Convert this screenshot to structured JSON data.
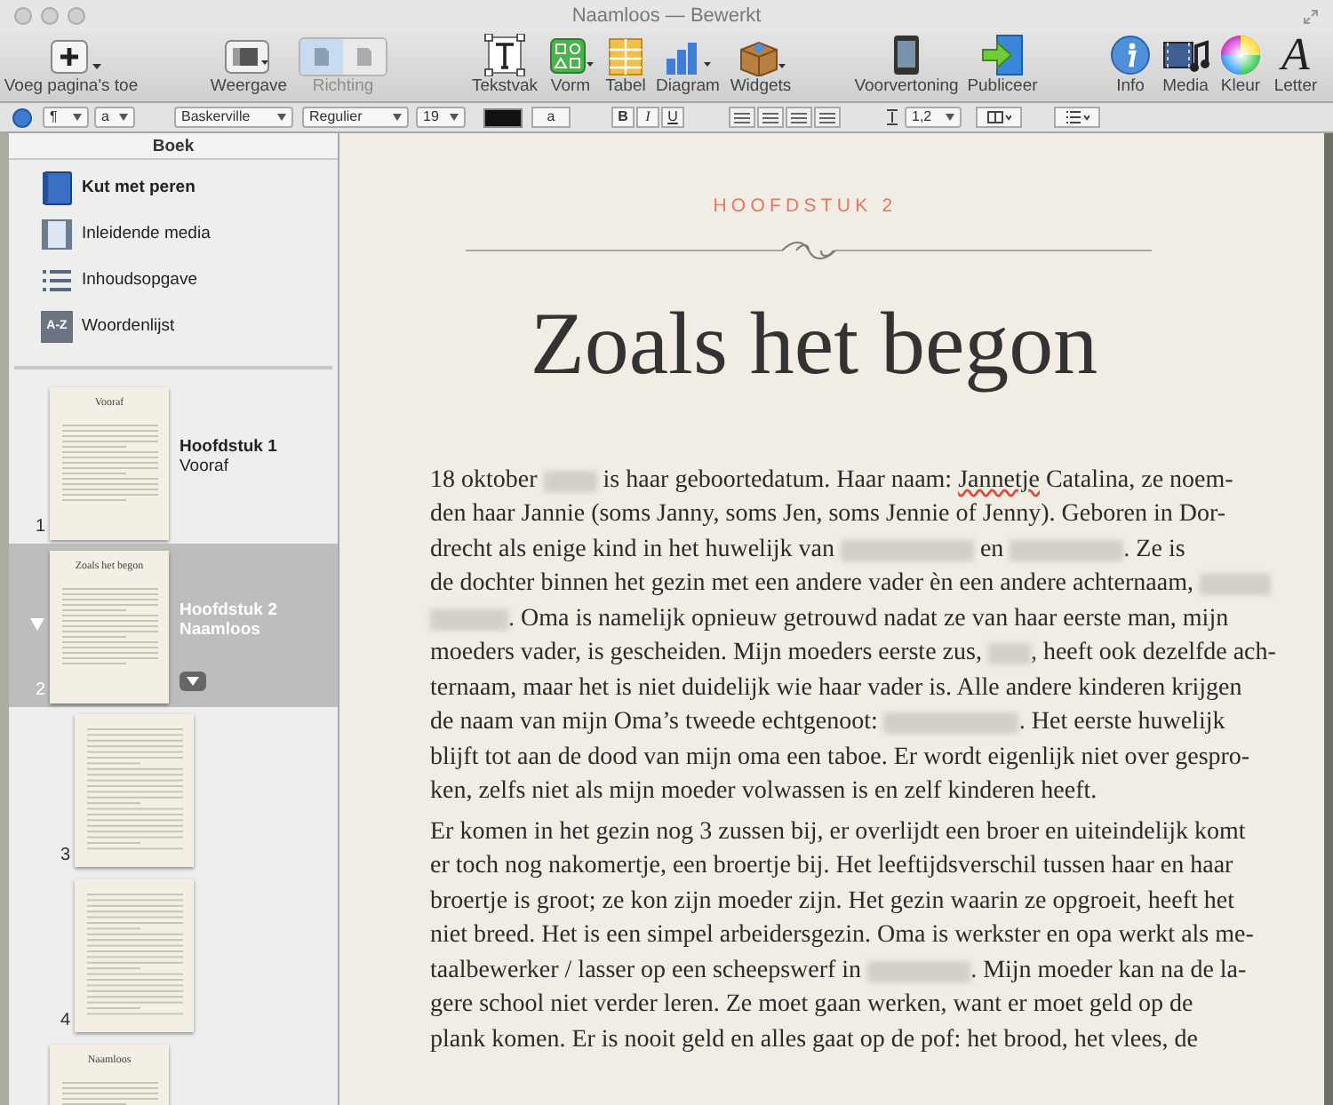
{
  "window": {
    "title": "Naamloos — Bewerkt"
  },
  "toolbar": [
    {
      "kind": "add_pages",
      "label": "Voeg pagina's toe",
      "disabled": false
    },
    {
      "kind": "view",
      "label": "Weergave",
      "disabled": false
    },
    {
      "kind": "orientation",
      "label": "Richting",
      "disabled": true,
      "segments": [
        {
          "selected": true
        },
        {
          "selected": false
        }
      ]
    },
    {
      "kind": "textbox",
      "label": "Tekstvak",
      "disabled": false
    },
    {
      "kind": "shape",
      "label": "Vorm",
      "disabled": false
    },
    {
      "kind": "table",
      "label": "Tabel",
      "disabled": false
    },
    {
      "kind": "chart",
      "label": "Diagram",
      "disabled": false
    },
    {
      "kind": "widget",
      "label": "Widgets",
      "disabled": false
    },
    {
      "kind": "preview",
      "label": "Voorvertoning",
      "disabled": false
    },
    {
      "kind": "publish",
      "label": "Publiceer",
      "disabled": false
    },
    {
      "kind": "info",
      "label": "Info",
      "disabled": false
    },
    {
      "kind": "media",
      "label": "Media",
      "disabled": false
    },
    {
      "kind": "color",
      "label": "Kleur",
      "disabled": false
    },
    {
      "kind": "font",
      "label": "Letter",
      "disabled": false,
      "glyph": "A"
    }
  ],
  "format_bar": {
    "paragraph_style": "¶",
    "character_style": "a",
    "font": "Baskerville",
    "typeface": "Regulier",
    "size": "19",
    "highlight": "a",
    "bold": "B",
    "italic": "I",
    "underline": "U",
    "line_spacing": "1,2"
  },
  "sidebar": {
    "header": "Boek",
    "items": [
      {
        "kind": "book",
        "label": "Kut met peren"
      },
      {
        "kind": "media",
        "label": "Inleidende media"
      },
      {
        "kind": "toc",
        "label": "Inhoudsopgave"
      },
      {
        "kind": "glossary",
        "label": "Woordenlijst",
        "badge": "A-Z"
      }
    ],
    "pages": [
      {
        "kind": "chapter",
        "number": "1",
        "title": "Hoofdstuk 1",
        "subtitle": "Vooraf",
        "thumb_title": "Vooraf",
        "selected": false
      },
      {
        "kind": "chapter",
        "number": "2",
        "title": "Hoofdstuk 2",
        "subtitle": "Naamloos",
        "thumb_title": "Zoals het begon",
        "selected": true
      },
      {
        "kind": "page",
        "number": "3",
        "selected": false
      },
      {
        "kind": "page",
        "number": "4",
        "selected": false
      },
      {
        "kind": "chapter",
        "thumb_title": "Naamloos",
        "selected": false
      }
    ]
  },
  "document": {
    "chapter_label": "HOOFDSTUK 2",
    "title": "Zoals het begon",
    "paragraphs": [
      [
        [
          "18 oktober ",
          {
            "kind": "redacted"
          },
          " is haar geboortedatum. Haar naam: ",
          {
            "kind": "misspelled",
            "text": "Jannetje"
          },
          " Catalina, ze noem-"
        ],
        [
          "den haar Jannie (soms Janny, soms Jen, soms Jennie of Jenny). Geboren in Dor-"
        ],
        [
          "drecht als enige kind in het huwelijk van ",
          {
            "kind": "redacted"
          },
          " en ",
          {
            "kind": "redacted"
          },
          ". Ze is"
        ],
        [
          "de dochter binnen het gezin met een andere vader èn een andere achternaam, ",
          {
            "kind": "redacted"
          }
        ],
        [
          {
            "kind": "redacted"
          },
          ". Oma is namelijk opnieuw getrouwd nadat ze van haar eerste man, mijn"
        ],
        [
          "moeders vader, is gescheiden. Mijn moeders eerste zus, ",
          {
            "kind": "redacted"
          },
          ", heeft ook dezelfde ach-"
        ],
        [
          "ternaam, maar het is niet duidelijk wie haar vader is. Alle andere kinderen krijgen"
        ],
        [
          "de naam van mijn Oma’s tweede echtgenoot: ",
          {
            "kind": "redacted"
          },
          ". Het eerste huwelijk"
        ],
        [
          "blijft tot aan de dood van mijn oma een taboe. Er wordt eigenlijk niet over gespro-"
        ],
        [
          "ken, zelfs niet als mijn moeder volwassen is en zelf kinderen heeft."
        ]
      ],
      [
        [
          "Er komen in het gezin nog 3 zussen bij, er overlijdt een broer en uiteindelijk komt"
        ],
        [
          "er toch nog nakomertje, een broertje bij. Het leeftijdsverschil tussen haar en haar"
        ],
        [
          "broertje is groot; ze kon zijn moeder zijn. Het gezin waarin ze opgroeit, heeft het"
        ],
        [
          "niet breed. Het is een simpel arbeidersgezin. Oma is werkster en opa werkt als me-"
        ],
        [
          "taalbewerker / lasser op een scheepswerf in ",
          {
            "kind": "redacted"
          },
          ". Mijn moeder kan na de la-"
        ],
        [
          "gere school niet verder leren. Ze moet gaan werken, want er moet geld op de"
        ],
        [
          "plank komen. Er is nooit geld en alles gaat op de pof: het brood, het vlees, de"
        ]
      ]
    ]
  }
}
